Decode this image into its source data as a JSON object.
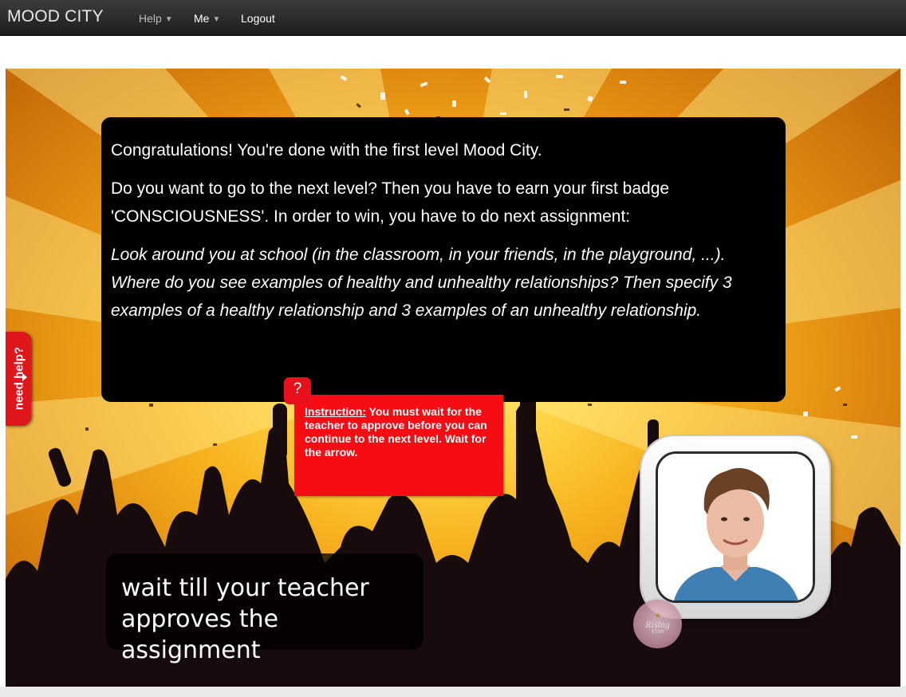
{
  "navbar": {
    "brand": "MOOD CITY",
    "help_label": "Help",
    "me_label": "Me",
    "logout_label": "Logout",
    "caret_icon": "caret-down-icon"
  },
  "message": {
    "paragraph1": "Congratulations! You're done with the first level Mood City.",
    "paragraph2": "Do you want to go to the next level? Then you have to earn your first badge 'CONSCIOUSNESS'. In order to win, you have to do next assignment:",
    "assignment": "Look around you at school (in the classroom, in your friends, in the playground, ...). Where do you see examples of healthy and unhealthy relationships? Then specify 3 examples of a healthy relationship and 3 examples of an unhealthy relationship."
  },
  "instruction": {
    "badge": "?",
    "label": "Instruction:",
    "text": " You must wait for the teacher to approve before you can continue to the next level. Wait for the arrow."
  },
  "help_tab": {
    "label": "need help?"
  },
  "wait": {
    "text": "wait till your teacher approves the assignment"
  },
  "seal": {
    "title": "Rising",
    "subtitle": "STAR"
  },
  "colors": {
    "accent_red": "#f50d13",
    "navbar": "#2a2a2a",
    "background_orange": "#f7b21f"
  }
}
